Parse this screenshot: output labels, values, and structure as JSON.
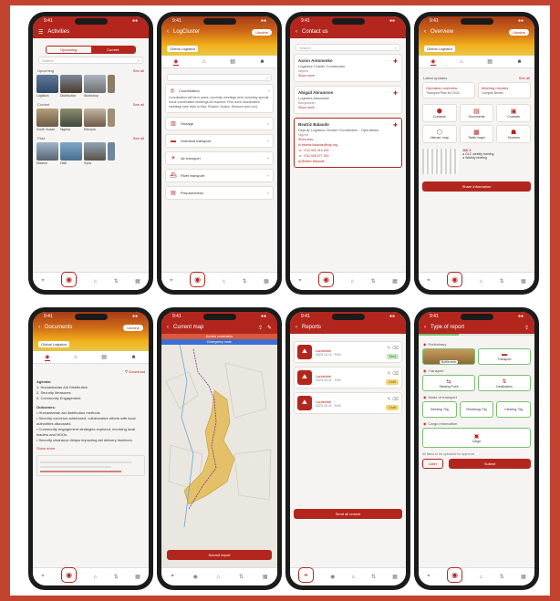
{
  "colors": {
    "background": "#c2432f",
    "brand": "#b3261e",
    "accent_yellow": "#e2b84a",
    "success": "#7cbf73"
  },
  "activities": {
    "title": "Activities",
    "toggle": [
      "Upcoming",
      "Current"
    ],
    "search_placeholder": "Search",
    "sections": [
      {
        "title": "Upcoming",
        "see_all": "See all",
        "items": [
          "Logistics",
          "Distribution",
          "Workshop",
          ""
        ]
      },
      {
        "title": "Current",
        "see_all": "See all",
        "items": [
          "South Sudan",
          "Nigeria",
          "Ethiopia",
          ""
        ]
      },
      {
        "title": "Past",
        "see_all": "See all",
        "items": [
          "Mission",
          "Haiti",
          "Syria",
          ""
        ]
      }
    ]
  },
  "logcluster": {
    "title": "LogCluster",
    "chip": "Global Logistics",
    "pill": "Ukraine",
    "coordination_label": "Coordination",
    "coordination_text": "Coordination will be in place, currently meetings held, including special focus coordination meetings as required. Find more coordination meetings (see links in Kiev, Kharkiv, Dnipro, Kherson and Lviv).",
    "rows": [
      "Storage",
      "Overland transport",
      "Air transport",
      "River transport",
      "Preparedness"
    ]
  },
  "contacts": {
    "title": "Contact us",
    "search_placeholder": "Search",
    "people": [
      {
        "name": "Aaron Antonenko",
        "role": "Logistics Cluster Coordinator",
        "loc": "Nigeria",
        "more": "Show more"
      },
      {
        "name": "Abigail Abramson",
        "role": "Logistics Associate",
        "loc": "Bangladesh",
        "more": "Show more"
      },
      {
        "name": "Beatriz Balaude",
        "role": "Deputy Logistics Cluster Coordinator - Operations",
        "loc": "Nigeria",
        "more": "Show less",
        "email": "beatriz.balaude@wfp.org",
        "phone1": "+211 922 414 415",
        "phone2": "+211 928 077 249",
        "skype": "Beatriz Balaude"
      }
    ]
  },
  "overview": {
    "title": "Overview",
    "chip": "Global Logistics",
    "pill": "Ukraine",
    "section_label": "Latest updates",
    "see_all": "See all",
    "cards": [
      {
        "title": "Operation overview",
        "sub": "Transport Plan for 2024"
      },
      {
        "title": "Meeting minutes",
        "sub": "Compile Benes"
      }
    ],
    "grid": [
      "Contacts",
      "Documents",
      "Contacts",
      "Interact. map",
      "Static maps",
      "Services"
    ],
    "calendar_day": "JUL 2",
    "events": [
      "GLC weekly training",
      "Weekly briefing"
    ],
    "share_button": "Share information"
  },
  "documents": {
    "title": "Documents",
    "chip": "Global Logistics",
    "pill": "Ukraine",
    "download": "Download",
    "agenda_title": "Agenda:",
    "agenda": [
      "1. Humanitarian Aid Distribution",
      "2. Security Measures",
      "3. Community Engagement"
    ],
    "outcomes_title": "Outcomes:",
    "outcomes": [
      "Humanitarian aid distribution methods",
      "Security concerns addressed, collaborative efforts with local authorities discussed.",
      "Community engagement strategies explored, involving local leaders and NGOs.",
      "Security clearance delays impacting aid delivery timelines."
    ],
    "show_more": "Show more"
  },
  "currentmap": {
    "title": "Current map",
    "banner1": "Access constraints",
    "banner2": "Emergency route",
    "submit": "Submit report"
  },
  "reports": {
    "title": "Reports",
    "items": [
      {
        "title": "Landslide",
        "date": "2023-10-11 · 9:00",
        "badge": "Sent",
        "kind": "g"
      },
      {
        "title": "Landslide",
        "date": "2023-10-11 · 9:00",
        "badge": "Draft",
        "kind": "y"
      },
      {
        "title": "Landslide",
        "date": "2023-10-11 · 9:00",
        "badge": "Draft",
        "kind": "y"
      }
    ],
    "send_all": "Send all unsent"
  },
  "report_type": {
    "title": "Type of report",
    "sec_preliminary": "Preliminary",
    "prelim_options": [
      "Bottleneck",
      "Transport"
    ],
    "sec_transport": "Transport",
    "transport_options": [
      "Starting Point",
      "Destination"
    ],
    "sec_mode": "Mode of transport",
    "mode_options": [
      "Sending 70g",
      "Receiving 70g",
      "Clearing 70g"
    ],
    "sec_cargo": "Cargo information",
    "cargo_option": "Cargo",
    "footer_text": "All items to be uploaded for approval",
    "later": "Later",
    "submit": "Submit"
  }
}
